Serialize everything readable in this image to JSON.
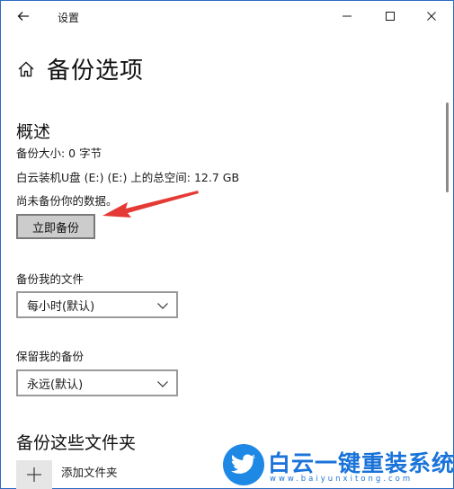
{
  "window": {
    "title": "设置"
  },
  "page": {
    "title": "备份选项"
  },
  "overview": {
    "heading": "概述",
    "size_line": "备份大小: 0 字节",
    "space_line": "白云装机U盘 (E:) (E:) 上的总空间: 12.7 GB",
    "status_line": "尚未备份你的数据。",
    "backup_button": "立即备份"
  },
  "frequency": {
    "label": "备份我的文件",
    "value": "每小时(默认)"
  },
  "retention": {
    "label": "保留我的备份",
    "value": "永远(默认)"
  },
  "folders": {
    "heading": "备份这些文件夹",
    "add_label": "添加文件夹"
  },
  "watermark": {
    "brand": "白云一键重装系统",
    "url": "www.baiyunxitong.com"
  },
  "colors": {
    "accent": "#1a73d9",
    "arrow": "#e53935",
    "frame": "#2b6cc4"
  }
}
